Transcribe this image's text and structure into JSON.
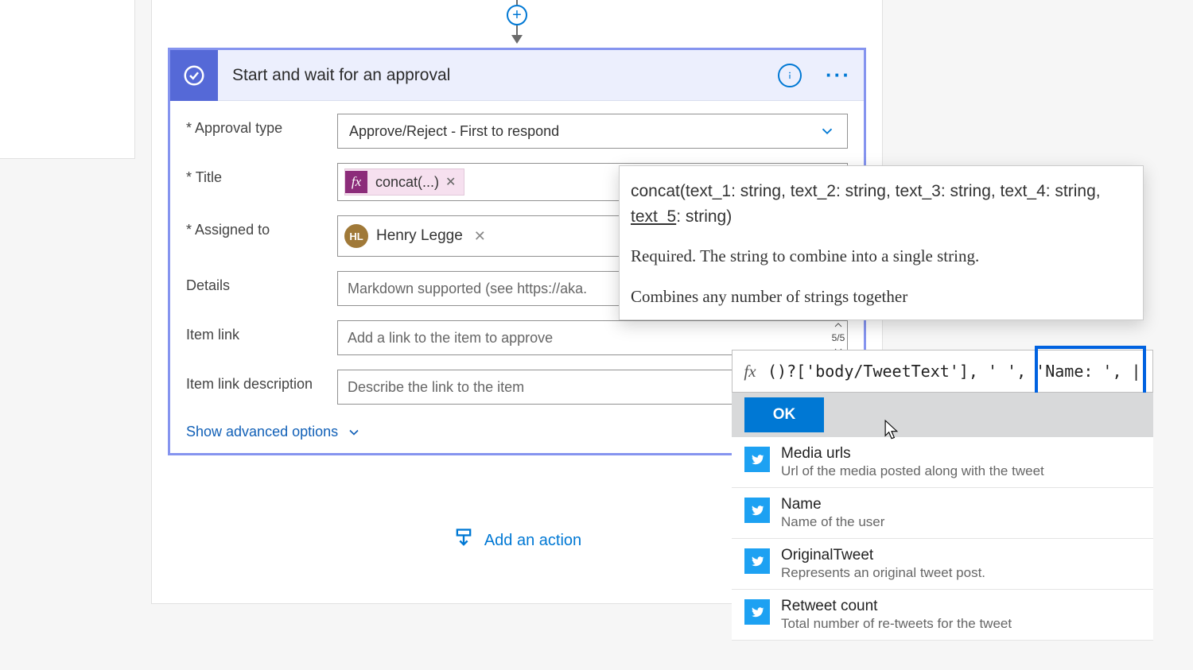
{
  "card": {
    "title": "Start and wait for an approval",
    "fields": {
      "approval_type_label": "Approval type",
      "approval_type_value": "Approve/Reject - First to respond",
      "title_label": "Title",
      "title_token": "concat(...)",
      "assigned_label": "Assigned to",
      "assigned_person": "Henry Legge",
      "assigned_initials": "HL",
      "details_label": "Details",
      "details_placeholder": "Markdown supported (see https://aka.",
      "item_link_label": "Item link",
      "item_link_placeholder": "Add a link to the item to approve",
      "item_link_step": "5/5",
      "item_link_desc_label": "Item link description",
      "item_link_desc_placeholder": "Describe the link to the item"
    },
    "advanced": "Show advanced options"
  },
  "tooltip": {
    "signature_pre": "concat(text_1: string, text_2: string, text_3: string, text_4: string, ",
    "signature_active": "text_5",
    "signature_post": ": string)",
    "required": "Required. The string to combine into a single string.",
    "summary": "Combines any number of strings together"
  },
  "expr": {
    "fx": "fx",
    "text": "()?['body/TweetText'], ' ', 'Name: ', |",
    "ok": "OK"
  },
  "dynamic": [
    {
      "title": "Media urls",
      "desc": "Url of the media posted along with the tweet"
    },
    {
      "title": "Name",
      "desc": "Name of the user"
    },
    {
      "title": "OriginalTweet",
      "desc": "Represents an original tweet post."
    },
    {
      "title": "Retweet count",
      "desc": "Total number of re-tweets for the tweet"
    }
  ],
  "add_action": "Add an action"
}
